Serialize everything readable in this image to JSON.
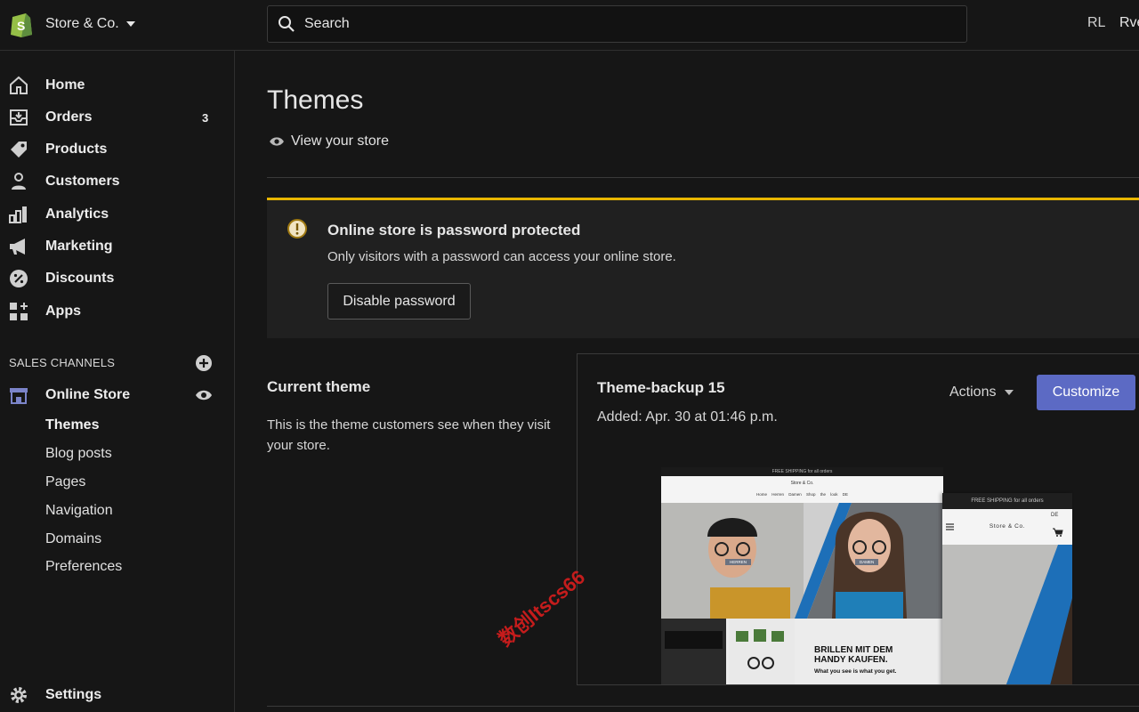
{
  "topbar": {
    "store_name": "Store & Co.",
    "search_placeholder": "Search",
    "user_initials": "RL",
    "user_name": "Rve"
  },
  "sidebar": {
    "items": [
      {
        "label": "Home",
        "icon": "home-icon"
      },
      {
        "label": "Orders",
        "icon": "orders-icon",
        "badge": "3"
      },
      {
        "label": "Products",
        "icon": "tag-icon"
      },
      {
        "label": "Customers",
        "icon": "person-icon"
      },
      {
        "label": "Analytics",
        "icon": "bar-chart-icon"
      },
      {
        "label": "Marketing",
        "icon": "megaphone-icon"
      },
      {
        "label": "Discounts",
        "icon": "discount-icon"
      },
      {
        "label": "Apps",
        "icon": "apps-icon"
      }
    ],
    "sales_channels_title": "SALES CHANNELS",
    "online_store": {
      "label": "Online Store",
      "sub_items": [
        "Themes",
        "Blog posts",
        "Pages",
        "Navigation",
        "Domains",
        "Preferences"
      ],
      "active": "Themes"
    },
    "settings_label": "Settings"
  },
  "main": {
    "title": "Themes",
    "view_store_label": "View your store",
    "banner": {
      "title": "Online store is password protected",
      "text": "Only visitors with a password can access your online store.",
      "button_label": "Disable password",
      "accent_color": "#e8b600"
    },
    "current_theme": {
      "section_title": "Current theme",
      "section_desc": "This is the theme customers see when they visit your store.",
      "name": "Theme-backup 15",
      "added": "Added: Apr. 30 at 01:46 p.m.",
      "actions_label": "Actions",
      "customize_label": "Customize",
      "customize_color": "#5c6ac4"
    },
    "preview": {
      "desktop_banner": "FREE SHIPPING for all orders",
      "desktop_store": "Store & Co.",
      "desktop_menu": "Home Herren Damen Shop the look DE",
      "hero_left_label": "HERREN",
      "hero_right_label": "DAMEN",
      "headline": "BRILLEN MIT DEM HANDY KAUFEN.",
      "subline": "What you see is what you get.",
      "mobile_banner": "FREE SHIPPING for all orders",
      "mobile_store": "Store & Co.",
      "mobile_lang": "DE"
    }
  },
  "watermark": "数创Itscs66"
}
